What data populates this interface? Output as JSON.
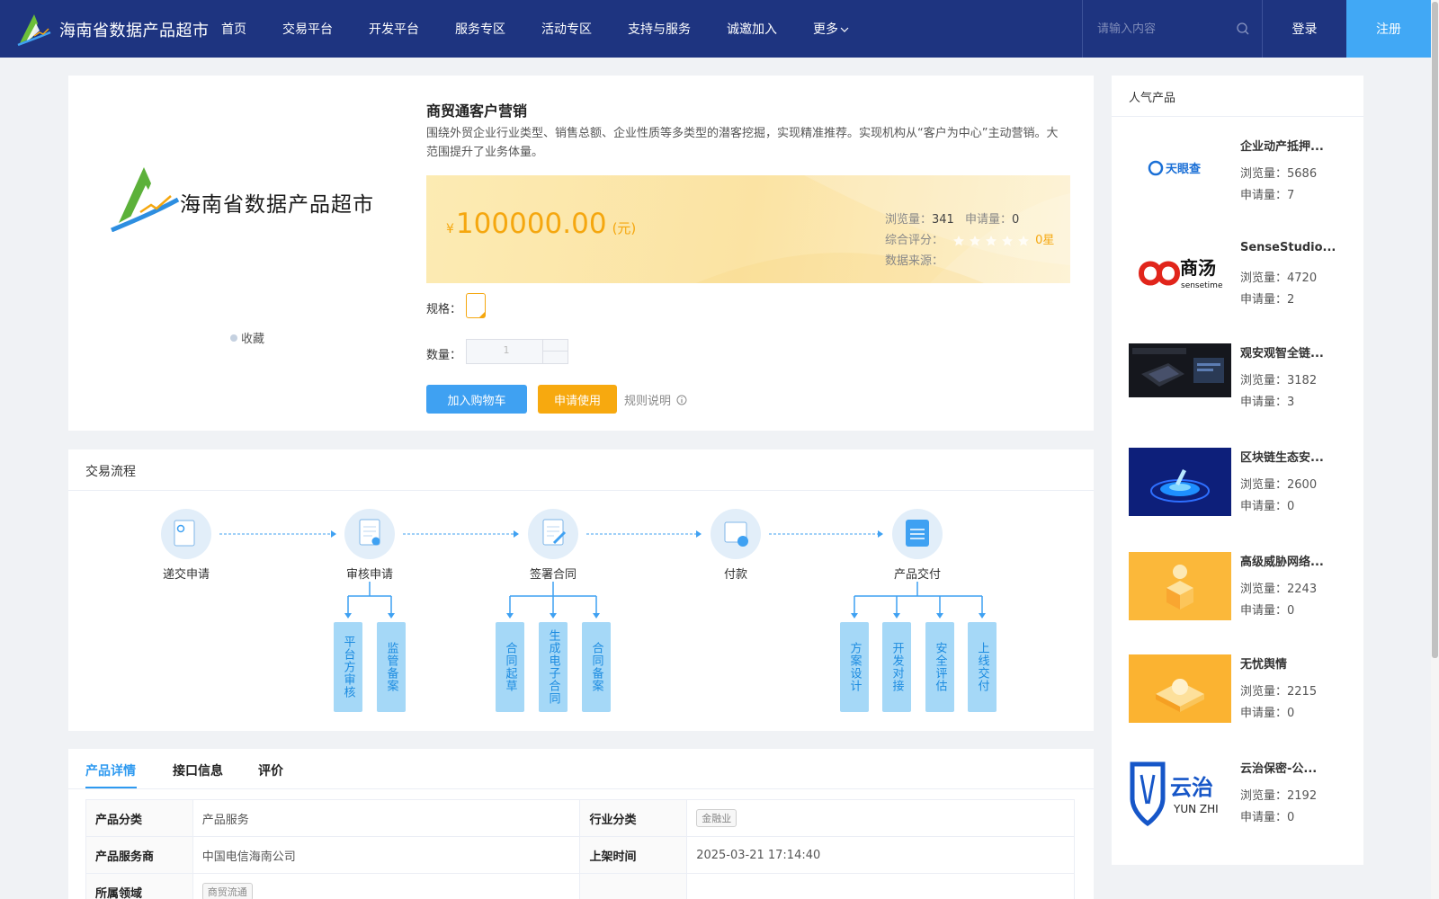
{
  "header": {
    "site_title": "海南省数据产品超市",
    "nav": [
      "首页",
      "交易平台",
      "开发平台",
      "服务专区",
      "活动专区",
      "支持与服务",
      "诚邀加入",
      "更多"
    ],
    "search_placeholder": "请输入内容",
    "login": "登录",
    "register": "注册"
  },
  "product": {
    "logo_text": "海南省数据产品超市",
    "collect": "收藏",
    "title": "商贸通客户营销",
    "description": "围绕外贸企业行业类型、销售总额、企业性质等多类型的潜客挖掘，实现精准推荐。实现机构从“客户为中心”主动营销。大范围提升了业务体量。",
    "currency": "¥",
    "price": "100000.00",
    "unit": "(元)",
    "views_label": "浏览量：",
    "views": "341",
    "apps_label": "申请量：",
    "apps": "0",
    "rating_label": "综合评分：",
    "rating": "0星",
    "rating_stars": 0,
    "source_label": "数据来源：",
    "spec_label": "规格：",
    "qty_label": "数量：",
    "qty": "1",
    "add_cart": "加入购物车",
    "apply": "申请使用",
    "rules": "规则说明"
  },
  "flow": {
    "title": "交易流程",
    "steps": [
      "递交申请",
      "审核申请",
      "签署合同",
      "付款",
      "产品交付"
    ],
    "sub_review": [
      "平台方审核",
      "监管备案"
    ],
    "sub_contract": [
      "合同起草",
      "生成电子合同",
      "合同备案"
    ],
    "sub_delivery": [
      "方案设计",
      "开发对接",
      "安全评估",
      "上线交付"
    ]
  },
  "detail": {
    "tabs": [
      "产品详情",
      "接口信息",
      "评价"
    ],
    "rows": [
      {
        "k1": "产品分类",
        "v1": "产品服务",
        "k2": "行业分类",
        "v2": "金融业"
      },
      {
        "k1": "产品服务商",
        "v1": "中国电信海南公司",
        "k2": "上架时间",
        "v2": "2025-03-21 17:14:40"
      },
      {
        "k1": "所属领域",
        "v1": "商贸流通",
        "k2": "",
        "v2": ""
      }
    ]
  },
  "sidebar": {
    "title": "人气产品",
    "views_label": "浏览量：",
    "apps_label": "申请量：",
    "items": [
      {
        "name": "企业动产抵押...",
        "views": "5686",
        "apps": "7",
        "thumb": "tianyancha-logo"
      },
      {
        "name": "SenseStudio...",
        "views": "4720",
        "apps": "2",
        "thumb": "sensetime-logo"
      },
      {
        "name": "观安观智全链...",
        "views": "3182",
        "apps": "3",
        "thumb": "dark-device-image"
      },
      {
        "name": "区块链生态安...",
        "views": "2600",
        "apps": "0",
        "thumb": "blockchain-image"
      },
      {
        "name": "高级威胁网络...",
        "views": "2243",
        "apps": "0",
        "thumb": "threat-image"
      },
      {
        "name": "无忧舆情",
        "views": "2215",
        "apps": "0",
        "thumb": "sentiment-image"
      },
      {
        "name": "云治保密-公...",
        "views": "2192",
        "apps": "0",
        "thumb": "yunzhi-logo"
      }
    ],
    "tianyancha_text": "天眼查",
    "sensetime_cn": "商汤",
    "sensetime_en": "sensetime",
    "yunzhi_cn": "云治",
    "yunzhi_en": "YUN ZHI"
  },
  "colors": {
    "header": "#1e3480",
    "accent": "#41a8f5",
    "price": "#f5a70f",
    "flow_line": "#3fa1f2"
  }
}
